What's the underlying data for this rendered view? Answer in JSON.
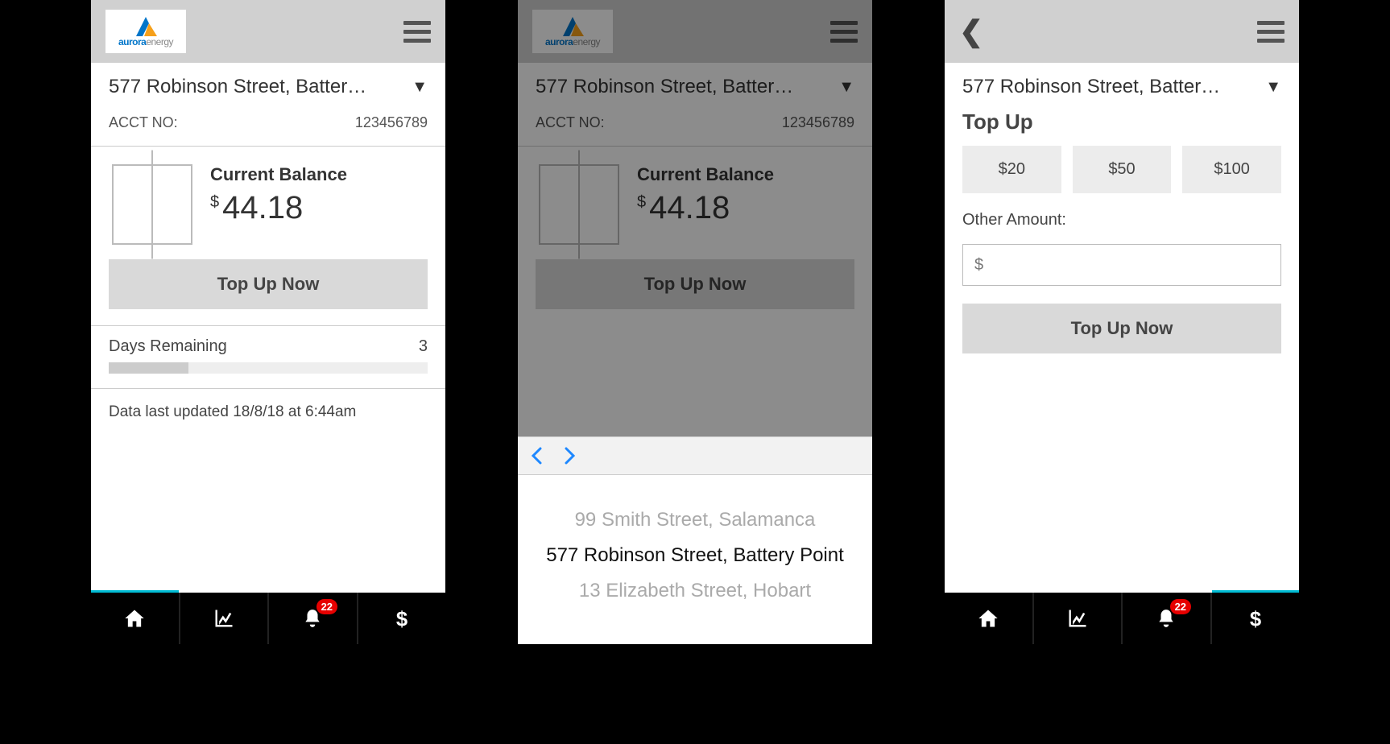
{
  "brand": {
    "name1": "aurora",
    "name2": "energy"
  },
  "address_truncated": "577 Robinson Street, Batter…",
  "account": {
    "label": "ACCT NO:",
    "number": "123456789"
  },
  "balance": {
    "label": "Current Balance",
    "currency": "$",
    "amount": "44.18"
  },
  "topup_button": "Top Up Now",
  "days": {
    "label": "Days Remaining",
    "value": "3"
  },
  "last_updated": "Data last updated 18/8/18 at 6:44am",
  "picker_options": [
    "99 Smith Street, Salamanca",
    "577 Robinson Street, Battery Point",
    "13 Elizabeth Street, Hobart"
  ],
  "picker_selected_index": 1,
  "topup": {
    "title": "Top Up",
    "amounts": [
      "$20",
      "$50",
      "$100"
    ],
    "other_label": "Other Amount:",
    "input_prefix": "$",
    "cta": "Top Up Now"
  },
  "tabbar": {
    "notif_badge": "22",
    "active_left": 0,
    "active_right": 3
  }
}
